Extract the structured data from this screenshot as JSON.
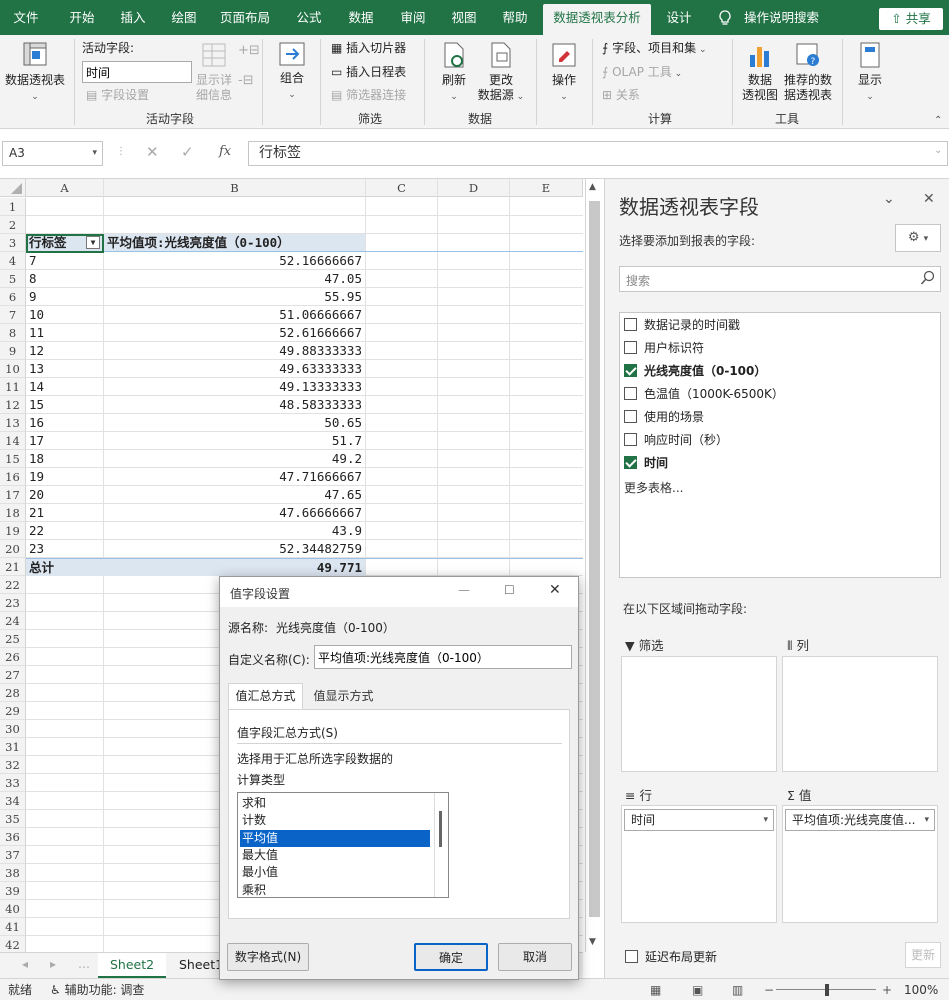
{
  "menubar": {
    "tabs": [
      "文件",
      "开始",
      "插入",
      "绘图",
      "页面布局",
      "公式",
      "数据",
      "审阅",
      "视图",
      "帮助",
      "数据透视表分析",
      "设计"
    ],
    "search_label": "操作说明搜索",
    "share_label": "共享"
  },
  "ribbon": {
    "pivottable_label": "数据透视表",
    "active_field_label": "活动字段:",
    "active_field_value": "时间",
    "field_settings": "字段设置",
    "show_details": "显示详",
    "show_details2": "细信息",
    "group_active_field": "活动字段",
    "group_label": "组合",
    "insert_slicer": "插入切片器",
    "insert_timeline": "插入日程表",
    "filter_connections": "筛选器连接",
    "group_filter": "筛选",
    "refresh": "刷新",
    "change_source1": "更改",
    "change_source2": "数据源",
    "group_data": "数据",
    "actions": "操作",
    "fields_items_sets": "字段、项目和集",
    "olap_tools": "OLAP 工具",
    "relationships": "关系",
    "group_calc": "计算",
    "pivotchart1": "数据",
    "pivotchart2": "透视图",
    "recommended1": "推荐的数",
    "recommended2": "据透视表",
    "group_tools": "工具",
    "show": "显示"
  },
  "formula_bar": {
    "name_box": "A3",
    "fx": "fx",
    "formula": "行标签"
  },
  "grid": {
    "columns": [
      "A",
      "B",
      "C",
      "D",
      "E"
    ],
    "row_numbers": [
      "1",
      "2",
      "3",
      "4",
      "5",
      "6",
      "7",
      "8",
      "9",
      "10",
      "11",
      "12",
      "13",
      "14",
      "15",
      "16",
      "17",
      "18",
      "19",
      "20",
      "21",
      "22",
      "23",
      "24",
      "25",
      "26",
      "27",
      "28",
      "29",
      "30",
      "31",
      "32",
      "33",
      "34",
      "35",
      "36",
      "37",
      "38",
      "39",
      "40",
      "41",
      "42"
    ],
    "pivot_header_a": "行标签",
    "pivot_header_b": "平均值项:光线亮度值（0-100）",
    "rows": [
      {
        "a": "7",
        "b": "52.16666667"
      },
      {
        "a": "8",
        "b": "47.05"
      },
      {
        "a": "9",
        "b": "55.95"
      },
      {
        "a": "10",
        "b": "51.06666667"
      },
      {
        "a": "11",
        "b": "52.61666667"
      },
      {
        "a": "12",
        "b": "49.88333333"
      },
      {
        "a": "13",
        "b": "49.63333333"
      },
      {
        "a": "14",
        "b": "49.13333333"
      },
      {
        "a": "15",
        "b": "48.58333333"
      },
      {
        "a": "16",
        "b": "50.65"
      },
      {
        "a": "17",
        "b": "51.7"
      },
      {
        "a": "18",
        "b": "49.2"
      },
      {
        "a": "19",
        "b": "47.71666667"
      },
      {
        "a": "20",
        "b": "47.65"
      },
      {
        "a": "21",
        "b": "47.66666667"
      },
      {
        "a": "22",
        "b": "43.9"
      },
      {
        "a": "23",
        "b": "52.34482759"
      }
    ],
    "total_label": "总计",
    "total_value": "49.771"
  },
  "sheet_tabs": [
    "Sheet2",
    "Sheet1"
  ],
  "status": {
    "ready": "就绪",
    "accessibility": "辅助功能: 调查",
    "zoom": "100%"
  },
  "pane": {
    "title": "数据透视表字段",
    "subtitle": "选择要添加到报表的字段:",
    "search_placeholder": "搜索",
    "fields": [
      {
        "label": "数据记录的时间戳",
        "checked": false
      },
      {
        "label": "用户标识符",
        "checked": false
      },
      {
        "label": "光线亮度值（0-100）",
        "checked": true
      },
      {
        "label": "色温值（1000K-6500K）",
        "checked": false
      },
      {
        "label": "使用的场景",
        "checked": false
      },
      {
        "label": "响应时间（秒）",
        "checked": false
      },
      {
        "label": "时间",
        "checked": true
      }
    ],
    "more_tables": "更多表格...",
    "drag_hint": "在以下区域间拖动字段:",
    "area_filter": "筛选",
    "area_columns": "列",
    "area_rows": "行",
    "area_values": "值",
    "row_field": "时间",
    "value_field": "平均值项:光线亮度值...",
    "defer_update": "延迟布局更新",
    "update_btn": "更新"
  },
  "dialog": {
    "title": "值字段设置",
    "source_label": "源名称:",
    "source_value": "光线亮度值（0-100）",
    "custom_name_label": "自定义名称(C):",
    "custom_name_value": "平均值项:光线亮度值（0-100）",
    "tab1": "值汇总方式",
    "tab2": "值显示方式",
    "section_label": "值字段汇总方式(S)",
    "desc1": "选择用于汇总所选字段数据的",
    "desc2": "计算类型",
    "options": [
      "求和",
      "计数",
      "平均值",
      "最大值",
      "最小值",
      "乘积"
    ],
    "selected": "平均值",
    "number_format": "数字格式(N)",
    "ok": "确定",
    "cancel": "取消"
  }
}
